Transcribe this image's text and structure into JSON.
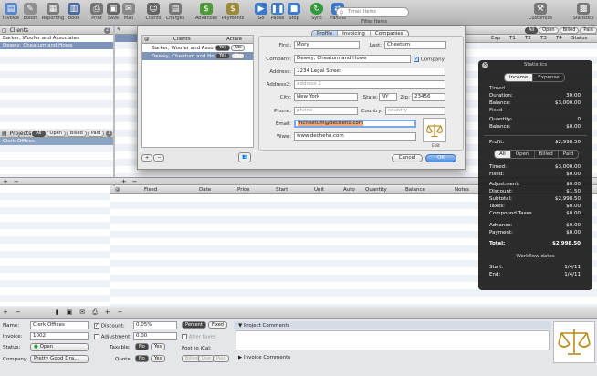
{
  "toolbar": {
    "items": [
      {
        "label": "Invoice",
        "icon": "invoice-icon",
        "color": "#5a86c8"
      },
      {
        "label": "Editor",
        "icon": "editor-icon",
        "color": "#8f8f8f"
      },
      {
        "label": "Reporting",
        "icon": "reporting-icon",
        "color": "#7a7a7a"
      },
      {
        "label": "Book",
        "icon": "book-icon",
        "color": "#4d6a9a"
      },
      {
        "label": "Print",
        "icon": "print-icon",
        "color": "#777"
      },
      {
        "label": "Save",
        "icon": "save-icon",
        "color": "#666"
      },
      {
        "label": "Mail",
        "icon": "mail-icon",
        "color": "#888"
      },
      {
        "label": "Clients",
        "icon": "clients-icon",
        "color": "#666"
      },
      {
        "label": "Charges",
        "icon": "charges-icon",
        "color": "#777"
      },
      {
        "label": "Advances",
        "icon": "advances-icon",
        "color": "#4c9a3a"
      },
      {
        "label": "Payments",
        "icon": "payments-icon",
        "color": "#9a8a3a"
      },
      {
        "label": "Go",
        "icon": "go-icon",
        "color": "#3d79c7"
      },
      {
        "label": "Pause",
        "icon": "pause-icon",
        "color": "#3d79c7"
      },
      {
        "label": "Stop",
        "icon": "stop-icon",
        "color": "#3d79c7"
      },
      {
        "label": "Sync",
        "icon": "sync-icon",
        "color": "#2e9a3a"
      },
      {
        "label": "Transfer",
        "icon": "transfer-icon",
        "color": "#3d79c7"
      },
      {
        "label": "Customize",
        "icon": "customize-icon",
        "color": "#777"
      },
      {
        "label": "Statistics",
        "icon": "statistics-icon",
        "color": "#777"
      }
    ],
    "search_placeholder": "Timed Items",
    "filter_label": "Filter Items"
  },
  "clients": {
    "header": "Clients",
    "count": "2",
    "rows": [
      "Barker, Woofer and Associates",
      "Dewey, Cheatum and Howe"
    ]
  },
  "projects": {
    "header": "Projects",
    "filters": [
      "All",
      "Open",
      "Billed",
      "Paid"
    ],
    "count": "1",
    "rows": [
      "Clerk Offices"
    ]
  },
  "right_filters": {
    "filters": [
      "All",
      "Open",
      "Billed",
      "Paid"
    ],
    "count": "1"
  },
  "top_columns": [
    "Exp",
    "T1",
    "T2",
    "T3",
    "T4",
    "Status"
  ],
  "items_columns": [
    "@",
    "Fixed",
    "Date",
    "Price",
    "Start",
    "Unit",
    "Auto",
    "Quantity",
    "Balance",
    "Notes"
  ],
  "dialog": {
    "list_headers": [
      "Clients",
      "Active"
    ],
    "list_rows": [
      {
        "name": "Barker, Woofer and Asso",
        "yes": "Yes",
        "no": "No"
      },
      {
        "name": "Dewey, Cheatum and Ho",
        "yes": "Yes",
        "no": "No"
      }
    ],
    "tabs": [
      "Profile",
      "Invoicing",
      "Companies"
    ],
    "first_label": "First:",
    "first": "Mory",
    "last_label": "Last:",
    "last": "Cheetum",
    "company_label": "Company:",
    "company": "Dewey, Cheatum and Howe",
    "company_check": "Company",
    "address_label": "Address:",
    "address": "1234 Legal Street",
    "address2_label": "Address2:",
    "address2_placeholder": "address 2",
    "city_label": "City:",
    "city": "New York",
    "state_label": "State:",
    "state": "NY",
    "zip_label": "Zip:",
    "zip": "23456",
    "phone_label": "Phone:",
    "phone_placeholder": "phone",
    "country_label": "Country:",
    "country_placeholder": "country",
    "email_label": "Email:",
    "email": "mcheetum@decheho.com",
    "www_label": "Www:",
    "www": "www.decheho.com",
    "edit_label": "Edit",
    "cancel": "Cancel",
    "ok": "OK"
  },
  "stats": {
    "title": "Statistics",
    "tabs": [
      "Income",
      "Expense"
    ],
    "timed_header": "Timed",
    "duration_label": "Duration:",
    "duration": "30:00",
    "balance_label": "Balance:",
    "balance": "$3,000.00",
    "fixed_header": "Fixed",
    "quantity_label": "Quantity:",
    "quantity": "0",
    "balance2_label": "Balance:",
    "balance2": "$0.00",
    "profit_label": "Profit:",
    "profit": "$2,998.50",
    "filters": [
      "All",
      "Open",
      "Billed",
      "Paid"
    ],
    "timed_label": "Timed:",
    "timed": "$3,000.00",
    "fixed_label": "Fixed:",
    "fixed": "$0.00",
    "adjustment_label": "Adjustment:",
    "adjustment": "$0.00",
    "discount_label": "Discount:",
    "discount": "$1.50",
    "subtotal_label": "Subtotal:",
    "subtotal": "$2,998.50",
    "taxes_label": "Taxes:",
    "taxes": "$0.00",
    "compound_label": "Compound Taxes",
    "compound": "$0.00",
    "advance_label": "Advance:",
    "advance": "$0.00",
    "payment_label": "Payment:",
    "payment": "$0.00",
    "total_label": "Total:",
    "total": "$2,998.50",
    "workflow_header": "Workflow dates",
    "start_label": "Start:",
    "start": "1/4/11",
    "end_label": "End:",
    "end": "1/4/11"
  },
  "bottom": {
    "name_label": "Name:",
    "name": "Clerk Offices",
    "invoice_label": "Invoice:",
    "invoice": "1002",
    "status_label": "Status:",
    "status": "Open",
    "company_label": "Company:",
    "company": "Pretty Good Dra...",
    "discount_label": "Discount:",
    "discount": "0.05%",
    "adjustment_label": "Adjustment:",
    "adjustment": "0.00",
    "after_taxes": "After taxes",
    "taxable_label": "Taxable:",
    "quote_label": "Quote:",
    "no": "No",
    "yes": "Yes",
    "percent": "Percent",
    "fixed": "Fixed",
    "post_label": "Post to iCal:",
    "post_buttons": [
      "Billed",
      "Due",
      "Paid"
    ],
    "project_comments": "Project Comments",
    "invoice_comments": "Invoice Comments"
  }
}
